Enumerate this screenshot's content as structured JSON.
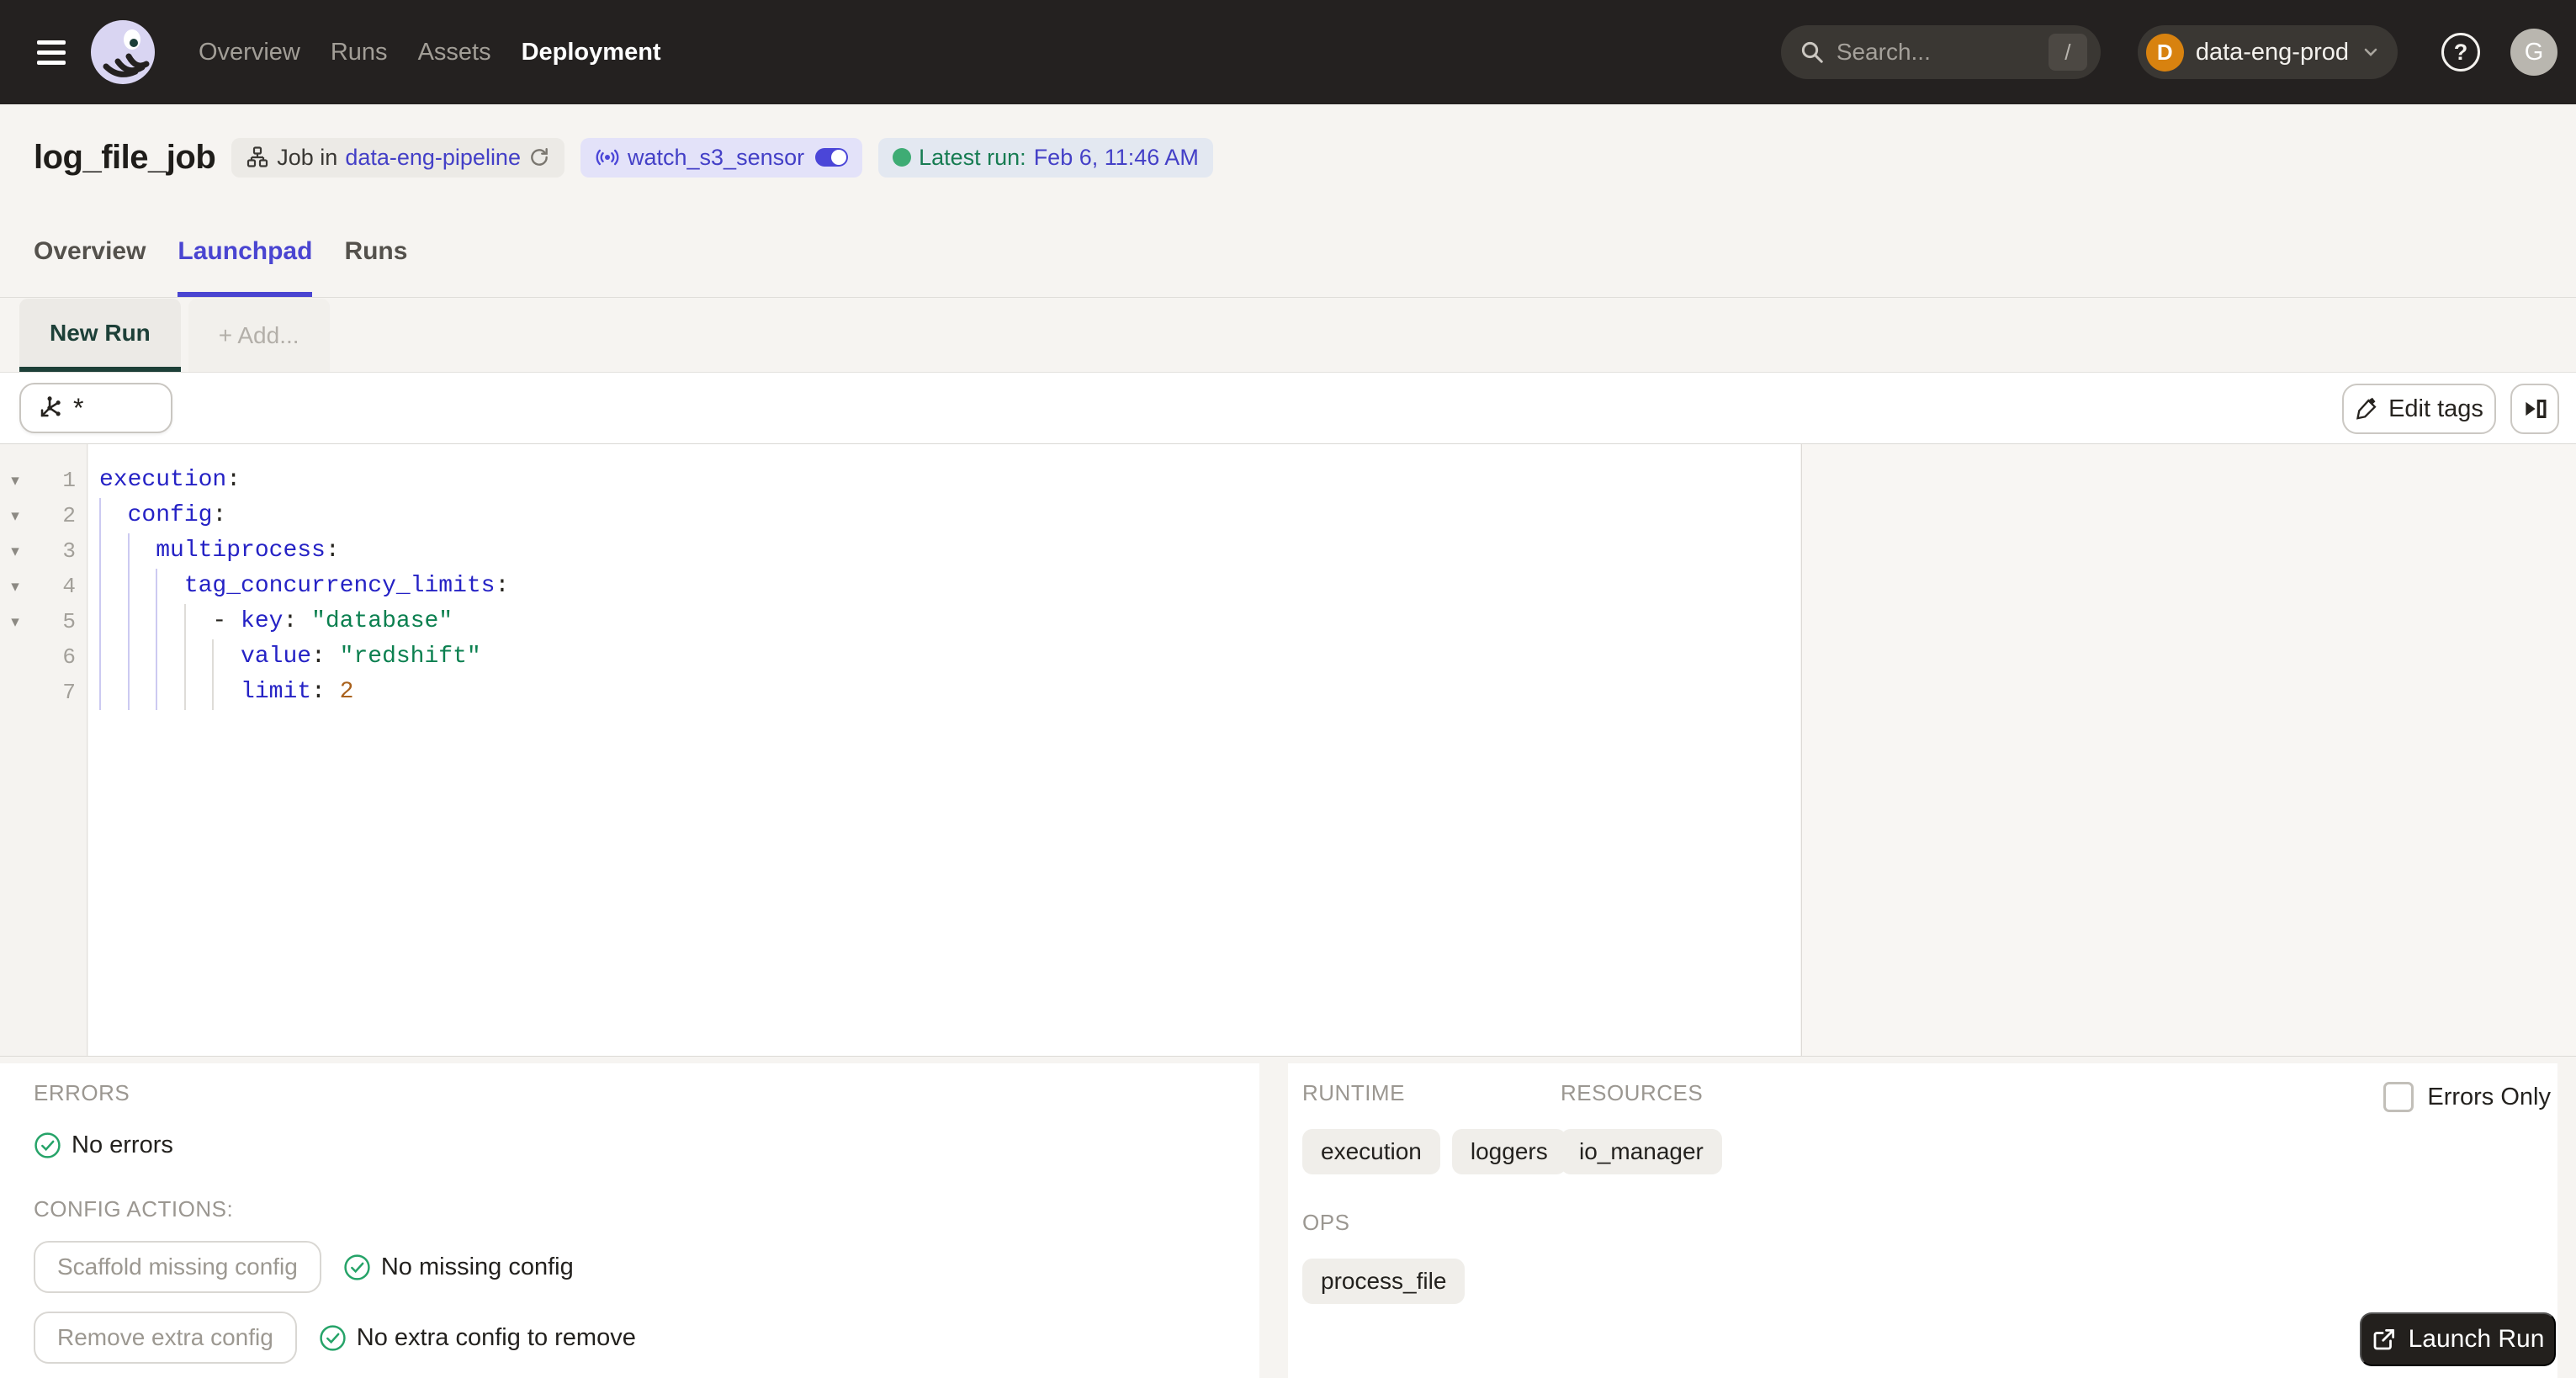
{
  "navbar": {
    "nav_items": [
      {
        "label": "Overview",
        "active": false
      },
      {
        "label": "Runs",
        "active": false
      },
      {
        "label": "Assets",
        "active": false
      },
      {
        "label": "Deployment",
        "active": true
      }
    ],
    "search": {
      "placeholder": "Search...",
      "shortcut": "/"
    },
    "deployment": {
      "initial": "D",
      "name": "data-eng-prod"
    },
    "help_glyph": "?",
    "user_initial": "G"
  },
  "header": {
    "title": "log_file_job",
    "job_tag": {
      "prefix": "Job in",
      "link": "data-eng-pipeline"
    },
    "sensor_tag": {
      "name": "watch_s3_sensor",
      "toggle_on": true
    },
    "latest_run_tag": {
      "label": "Latest run:",
      "value": "Feb 6, 11:46 AM"
    }
  },
  "tabs": [
    {
      "label": "Overview",
      "active": false
    },
    {
      "label": "Launchpad",
      "active": true
    },
    {
      "label": "Runs",
      "active": false
    }
  ],
  "launchpad": {
    "config_tabs": [
      {
        "label": "New Run",
        "active": true
      },
      {
        "label": "+ Add...",
        "active": false
      }
    ],
    "op_selector": {
      "value": "*"
    },
    "toolbar": {
      "edit_tags_label": "Edit tags"
    },
    "editor": {
      "lines": [
        {
          "fold": true,
          "tokens": [
            [
              "key",
              "execution"
            ],
            [
              "pun",
              ":"
            ]
          ]
        },
        {
          "fold": true,
          "tokens": [
            [
              "sp",
              "  "
            ],
            [
              "key",
              "config"
            ],
            [
              "pun",
              ":"
            ]
          ]
        },
        {
          "fold": true,
          "tokens": [
            [
              "sp",
              "    "
            ],
            [
              "key",
              "multiprocess"
            ],
            [
              "pun",
              ":"
            ]
          ]
        },
        {
          "fold": true,
          "tokens": [
            [
              "sp",
              "      "
            ],
            [
              "key",
              "tag_concurrency_limits"
            ],
            [
              "pun",
              ":"
            ]
          ]
        },
        {
          "fold": true,
          "tokens": [
            [
              "sp",
              "        "
            ],
            [
              "pun",
              "- "
            ],
            [
              "key",
              "key"
            ],
            [
              "pun",
              ":"
            ],
            [
              "sp",
              " "
            ],
            [
              "str",
              "\"database\""
            ]
          ]
        },
        {
          "fold": false,
          "tokens": [
            [
              "sp",
              "          "
            ],
            [
              "key",
              "value"
            ],
            [
              "pun",
              ":"
            ],
            [
              "sp",
              " "
            ],
            [
              "str",
              "\"redshift\""
            ]
          ]
        },
        {
          "fold": false,
          "tokens": [
            [
              "sp",
              "          "
            ],
            [
              "key",
              "limit"
            ],
            [
              "pun",
              ":"
            ],
            [
              "sp",
              " "
            ],
            [
              "num",
              "2"
            ]
          ]
        }
      ]
    }
  },
  "bottom": {
    "errors": {
      "heading": "ERRORS",
      "status": "No errors"
    },
    "config_actions": {
      "heading": "CONFIG ACTIONS:",
      "actions": [
        {
          "button": "Scaffold missing config",
          "status": "No missing config"
        },
        {
          "button": "Remove extra config",
          "status": "No extra config to remove"
        }
      ]
    },
    "runtime": {
      "heading": "RUNTIME",
      "chips": [
        "execution",
        "loggers"
      ]
    },
    "resources": {
      "heading": "RESOURCES",
      "chips": [
        "io_manager"
      ]
    },
    "ops": {
      "heading": "OPS",
      "chips": [
        "process_file"
      ]
    },
    "errors_only_label": "Errors Only",
    "launch_button": "Launch Run"
  },
  "colors": {
    "accent_indigo": "#4A45D1",
    "link_blue": "#4440C7",
    "success_green": "#1E9E63",
    "deployment_orange": "#D8820F",
    "navbar_dark": "#242120",
    "yaml_key": "#2522C5",
    "yaml_string": "#0C8050",
    "yaml_number": "#A9611C"
  }
}
